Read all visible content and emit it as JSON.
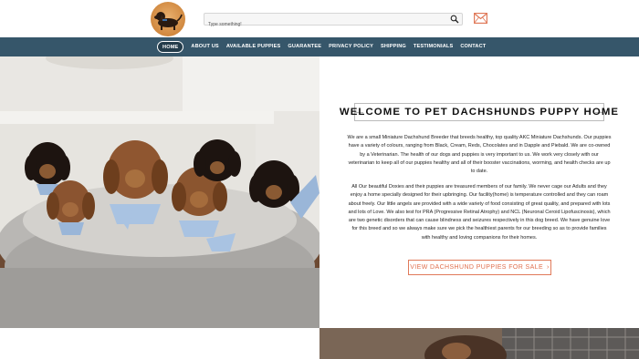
{
  "header": {
    "logo_icon": "dachshund-logo-icon",
    "search": {
      "placeholder": "Type something!",
      "icon": "search-icon"
    },
    "mail_icon": "envelope-icon",
    "accent": "#e07a5a"
  },
  "nav": {
    "background": "#36566a",
    "items": [
      {
        "label": "HOME",
        "active": true
      },
      {
        "label": "ABOUT US"
      },
      {
        "label": "AVAILABLE PUPPIES"
      },
      {
        "label": "GUARANTEE"
      },
      {
        "label": "PRIVACY POLICY"
      },
      {
        "label": "SHIPPING"
      },
      {
        "label": "TESTIMONIALS"
      },
      {
        "label": "CONTACT"
      }
    ]
  },
  "main": {
    "heading": "WELCOME TO PET DACHSHUNDS PUPPY HOME",
    "paragraph1": "We are a small Miniature Dachshund Breeder that breeds healthy, top quality AKC Miniature Dachshunds. Our puppies have a variety of colours, ranging from Black, Cream, Reds, Chocolates and in Dapple and Piebald. We are co-owned by a Veterinarian. The health of our dogs and puppies is very important to us. We work very closely with our veterinarian to keep all of our puppies healthy and all of their booster vaccinations, worming, and health checks are up to date.",
    "paragraph2": "All Our beautiful Doxies and their puppies are treasured members of our family. We never cage our Adults and they enjoy a home specially designed for their upbringing. Our facility(home) is temperature controlled and they can roam about freely. Our little angels are provided with a wide variety of food consisting of great quality, and prepared with lots and lots of Love. We also test for PRA (Progressive Retinal Atrophy) and NCL (Neuronal Ceroid Lipofuscinosis), which are two genetic disorders that can cause blindness and seizures respectively in this dog breed. We have genuine love for this breed and so we always make sure we pick the healthiest parents for our breeding so as to provide families with healthy and loving companions for their homes.",
    "cta_label": "VIEW DACHSHUND PUPPIES FOR SALE",
    "cta_icon": "chevron-right-icon"
  }
}
